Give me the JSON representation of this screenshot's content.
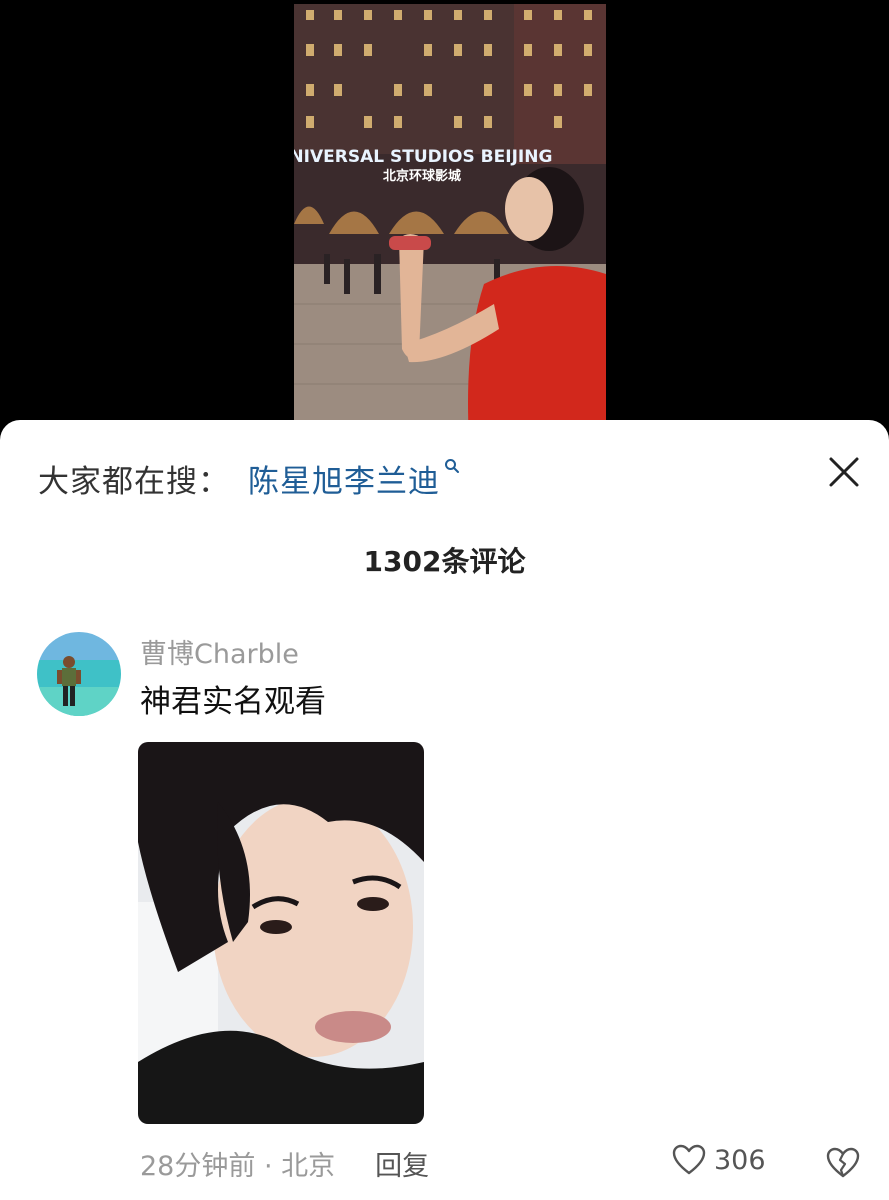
{
  "video": {
    "sign_line1": "UNIVERSAL STUDIOS BEIJING",
    "sign_line2": "北京环球影城"
  },
  "search_bar": {
    "prefix": "大家都在搜：",
    "term": "陈星旭李兰迪",
    "icon": "search-icon"
  },
  "close": {
    "icon": "close-icon"
  },
  "comments": {
    "count_label": "1302条评论",
    "items": [
      {
        "username": "曹博Charble",
        "text": "神君实名观看",
        "meta": "28分钟前 · 北京",
        "reply_label": "回复",
        "like_count": "306",
        "like_icon": "heart-icon",
        "dislike_icon": "broken-heart-icon"
      }
    ]
  },
  "colors": {
    "search_term": "#1f5d96",
    "muted_text": "#9a9a9a",
    "sheet_bg": "#ffffff",
    "video_bg": "#000000"
  }
}
